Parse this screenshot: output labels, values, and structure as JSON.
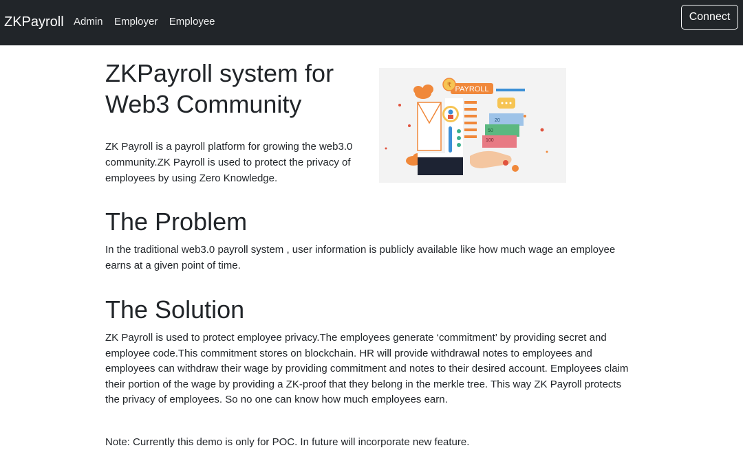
{
  "navbar": {
    "brand": "ZKPayroll",
    "links": [
      "Admin",
      "Employer",
      "Employee"
    ],
    "connect_label": "Connect"
  },
  "hero": {
    "title": "ZKPayroll system for Web3 Community",
    "description": "ZK Payroll is a payroll platform for growing the web3.0 community.ZK Payroll is used to protect the privacy of employees by using Zero Knowledge.",
    "illustration": {
      "badge_text": "PAYROLL",
      "coin_symbol": "₹",
      "bill_values": [
        "20",
        "50",
        "100"
      ]
    }
  },
  "problem": {
    "title": "The Problem",
    "text": "In the traditional web3.0 payroll system , user information is publicly available like how much wage an employee earns at a given point of time."
  },
  "solution": {
    "title": "The Solution",
    "text": "ZK Payroll is used to protect employee privacy.The employees generate ‘commitment’ by providing secret and employee code.This commitment stores on blockchain. HR will provide withdrawal notes to employees and employees can withdraw their wage by providing commitment and notes to their desired account. Employees claim their portion of the wage by providing a ZK-proof that they belong in the merkle tree. This way ZK Payroll protects the privacy of employees. So no one can know how much employees earn."
  },
  "note": "Note: Currently this demo is only for POC. In future will incorporate new feature.",
  "colors": {
    "navbar_bg": "#212529",
    "text": "#212529",
    "accent_orange": "#f0883a",
    "accent_blue": "#3b8fd6",
    "accent_red": "#e0533e"
  }
}
